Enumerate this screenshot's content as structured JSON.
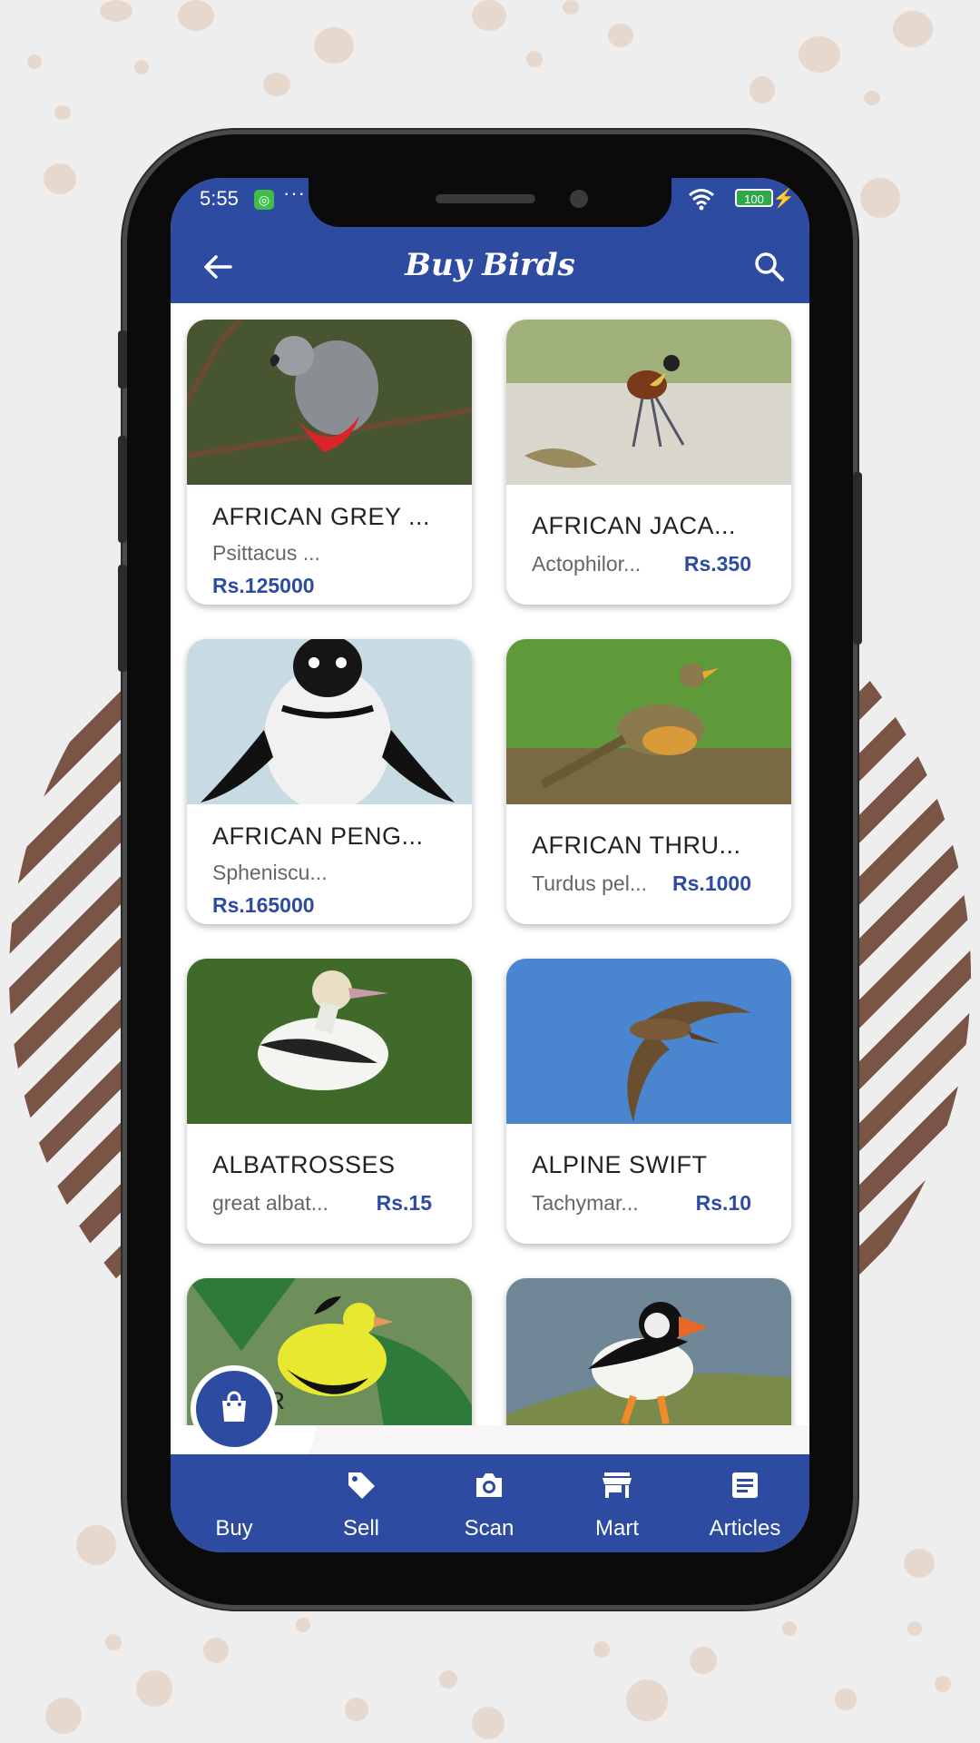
{
  "status_bar": {
    "time": "5:55",
    "more": "···",
    "battery": "100"
  },
  "app_bar": {
    "title": "Buy Birds"
  },
  "birds": [
    {
      "name": "AFRICAN GREY ...",
      "scientific": "Psittacus ...",
      "price": "Rs.125000"
    },
    {
      "name": "AFRICAN JACA...",
      "scientific": "Actophilor...",
      "price": "Rs.350"
    },
    {
      "name": "AFRICAN PENG...",
      "scientific": "Spheniscu...",
      "price": "Rs.165000"
    },
    {
      "name": "AFRICAN THRU...",
      "scientific": "Turdus pel...",
      "price": "Rs.1000"
    },
    {
      "name": "ALBATROSSES",
      "scientific": "great albat...",
      "price": "Rs.15"
    },
    {
      "name": "ALPINE SWIFT",
      "scientific": "Tachymar...",
      "price": "Rs.10"
    }
  ],
  "partial_card_name": "AMER",
  "bottom_nav": [
    {
      "label": "Buy",
      "icon": "shopping-bag-icon"
    },
    {
      "label": "Sell",
      "icon": "tag-icon"
    },
    {
      "label": "Scan",
      "icon": "camera-icon"
    },
    {
      "label": "Mart",
      "icon": "store-icon"
    },
    {
      "label": "Articles",
      "icon": "article-icon"
    }
  ],
  "colors": {
    "primary": "#2d4ba0",
    "accent_stripes": "#7a5546",
    "background": "#efeeee"
  }
}
